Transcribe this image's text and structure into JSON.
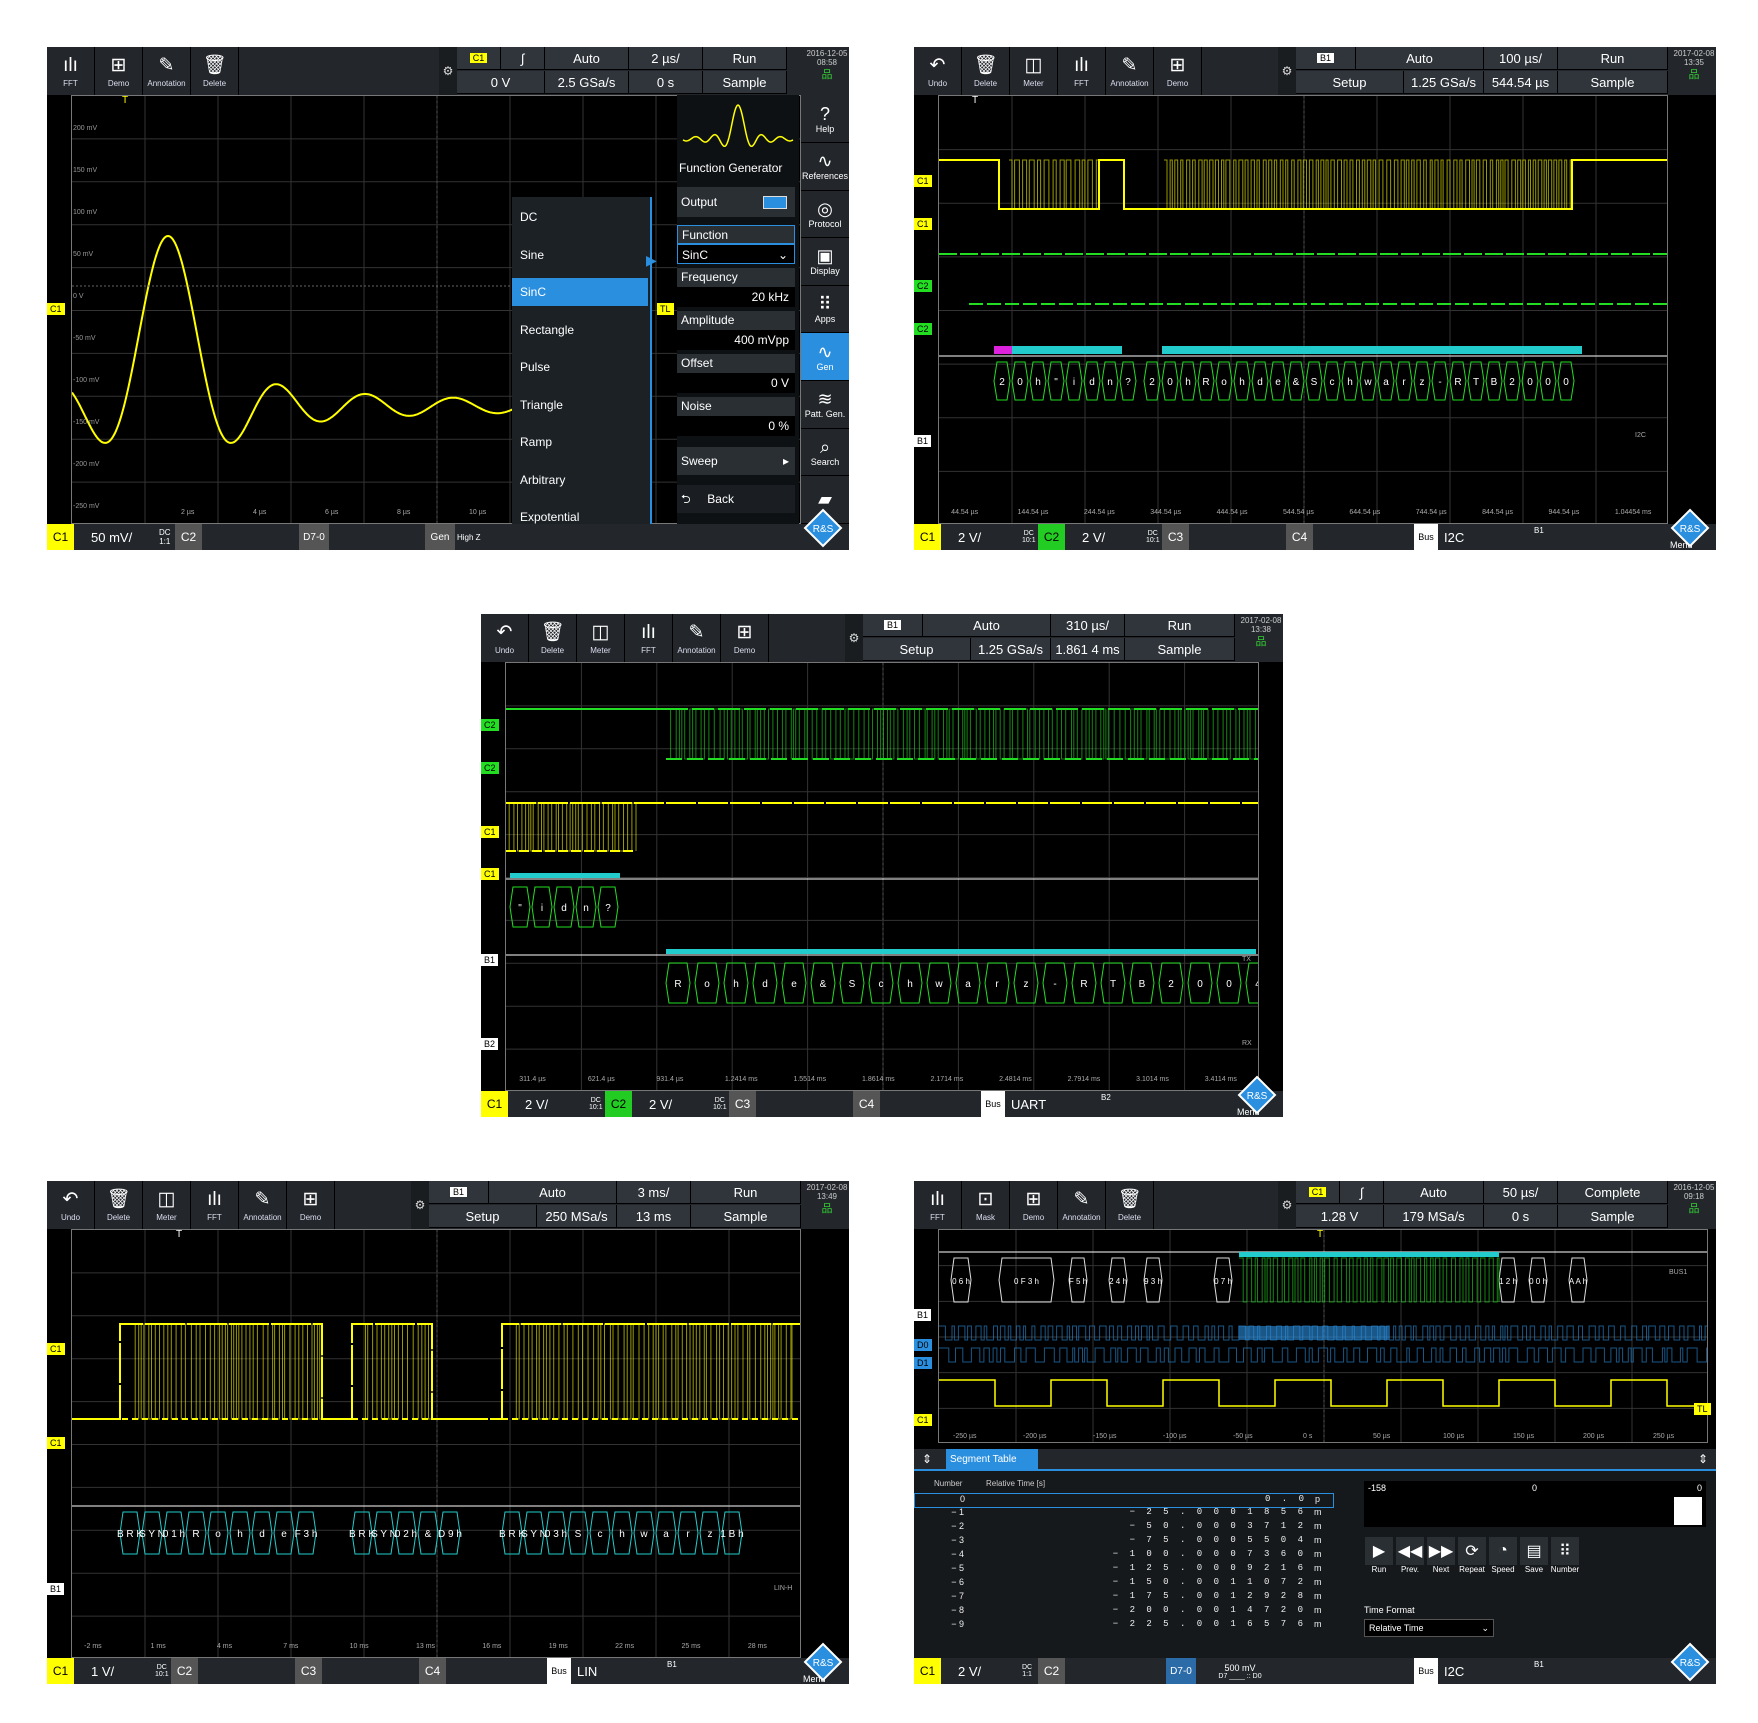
{
  "screens": [
    {
      "toolbar": [
        {
          "label": "FFT",
          "icon": "fft-icon"
        },
        {
          "label": "Demo",
          "icon": "demo-icon"
        },
        {
          "label": "Annotation",
          "icon": "pen-icon"
        },
        {
          "label": "Delete",
          "icon": "trash-icon"
        }
      ],
      "acq": {
        "ch": "C1",
        "slope": "∫",
        "mode": "Auto",
        "tb": "2 µs/",
        "run": "Run",
        "level": "0 V",
        "rate": "2.5 GSa/s",
        "pos": "0 s",
        "acqmode": "Sample"
      },
      "date": "2016-12-05",
      "time": "08:58",
      "levels": [
        "200 mV",
        "150 mV",
        "100 mV",
        "50 mV",
        "0 V",
        "-50 mV",
        "-100 mV",
        "-150 mV",
        "-200 mV",
        "-250 mV"
      ],
      "times": [
        "2 µs",
        "4 µs",
        "6 µs",
        "8 µs",
        "10 µs"
      ],
      "menu": [
        "DC",
        "Sine",
        "SinC",
        "Rectangle",
        "Pulse",
        "Triangle",
        "Ramp",
        "Arbitrary",
        "Expotential"
      ],
      "menu_selected": 2,
      "fg": {
        "title": "Function Generator",
        "output": "Output",
        "function_label": "Function",
        "function_value": "SinC",
        "frequency_label": "Frequency",
        "frequency_value": "20 kHz",
        "amplitude_label": "Amplitude",
        "amplitude_value": "400 mVpp",
        "offset_label": "Offset",
        "offset_value": "0 V",
        "noise_label": "Noise",
        "noise_value": "0 %",
        "sweep": "Sweep",
        "back": "Back"
      },
      "side": [
        {
          "label": "Help",
          "icon": "help-icon"
        },
        {
          "label": "References",
          "icon": "references-icon"
        },
        {
          "label": "Protocol",
          "icon": "protocol-icon"
        },
        {
          "label": "Display",
          "icon": "display-icon"
        },
        {
          "label": "Apps",
          "icon": "apps-icon"
        },
        {
          "label": "Gen",
          "icon": "gen-icon"
        },
        {
          "label": "Patt. Gen.",
          "icon": "pattern-icon"
        },
        {
          "label": "Search",
          "icon": "search-icon"
        },
        {
          "label": "",
          "icon": "folder-icon"
        }
      ],
      "bottom": {
        "c1": "C1",
        "c1_scale": "50 mV/",
        "c1_cpl": "DC",
        "c1_ratio": "1:1",
        "c2": "C2",
        "d70": "D7-0",
        "gen": "Gen",
        "gen_sub": "High Z"
      },
      "markers": {
        "t": "T",
        "ch": "C1",
        "tl": "TL"
      }
    },
    {
      "toolbar": [
        {
          "label": "Undo",
          "icon": "undo-icon"
        },
        {
          "label": "Delete",
          "icon": "trash-icon"
        },
        {
          "label": "Meter",
          "icon": "meter-icon"
        },
        {
          "label": "FFT",
          "icon": "fft-icon"
        },
        {
          "label": "Annotation",
          "icon": "pen-icon"
        },
        {
          "label": "Demo",
          "icon": "demo-icon"
        }
      ],
      "acq": {
        "ch": "B1",
        "mode": "Auto",
        "tb": "100 µs/",
        "run": "Run",
        "level": "Setup",
        "rate": "1.25 GSa/s",
        "pos": "544.54 µs",
        "acqmode": "Sample"
      },
      "date": "2017-02-08",
      "time": "13:35",
      "times": [
        "44.54 µs",
        "144.54 µs",
        "244.54 µs",
        "344.54 µs",
        "444.54 µs",
        "544.54 µs",
        "644.54 µs",
        "744.54 µs",
        "844.54 µs",
        "944.54 µs",
        "1.04454 ms"
      ],
      "decode1": [
        "2",
        "0",
        "h",
        "\"",
        "i",
        "d",
        "n",
        "?"
      ],
      "decode2": [
        "2",
        "0",
        "h",
        "R",
        "o",
        "h",
        "d",
        "e",
        "&",
        "S",
        "c",
        "h",
        "w",
        "a",
        "r",
        "z",
        "-",
        "R",
        "T",
        "B",
        "2",
        "0",
        "0",
        "0"
      ],
      "buslabel": "I2C",
      "chlabels": [
        "C1",
        "C1",
        "C2",
        "C2",
        "B1"
      ],
      "bottom": {
        "c1": "C1",
        "c1_scale": "2 V/",
        "c1_cpl": "DC",
        "c1_ratio": "10:1",
        "c2": "C2",
        "c2_scale": "2 V/",
        "c2_cpl": "DC",
        "c2_ratio": "10:1",
        "c3": "C3",
        "c4": "C4",
        "bus": "Bus",
        "bus_name": "I2C",
        "bus_id": "B1",
        "menu": "Menu"
      }
    },
    {
      "toolbar": [
        {
          "label": "Undo",
          "icon": "undo-icon"
        },
        {
          "label": "Delete",
          "icon": "trash-icon"
        },
        {
          "label": "Meter",
          "icon": "meter-icon"
        },
        {
          "label": "FFT",
          "icon": "fft-icon"
        },
        {
          "label": "Annotation",
          "icon": "pen-icon"
        },
        {
          "label": "Demo",
          "icon": "demo-icon"
        }
      ],
      "acq": {
        "ch": "B1",
        "mode": "Auto",
        "tb": "310 µs/",
        "run": "Run",
        "level": "Setup",
        "rate": "1.25 GSa/s",
        "pos": "1.861 4 ms",
        "acqmode": "Sample"
      },
      "date": "2017-02-08",
      "time": "13:38",
      "times": [
        "311.4 µs",
        "621.4 µs",
        "931.4 µs",
        "1.2414 ms",
        "1.5514 ms",
        "1.8614 ms",
        "2.1714 ms",
        "2.4814 ms",
        "2.7914 ms",
        "3.1014 ms",
        "3.4114 ms"
      ],
      "decode1": [
        "\"",
        "i",
        "d",
        "n",
        "?"
      ],
      "decode2": [
        "R",
        "o",
        "h",
        "d",
        "e",
        "&",
        "S",
        "c",
        "h",
        "w",
        "a",
        "r",
        "z",
        "-",
        "R",
        "T",
        "B",
        "2",
        "0",
        "0",
        "4"
      ],
      "tx": "TX",
      "rx": "RX",
      "chlabels": [
        "C2",
        "C2",
        "C1",
        "C1",
        "B1",
        "B2"
      ],
      "bottom": {
        "c1": "C1",
        "c1_scale": "2 V/",
        "c1_cpl": "DC",
        "c1_ratio": "10:1",
        "c2": "C2",
        "c2_scale": "2 V/",
        "c2_cpl": "DC",
        "c2_ratio": "10:1",
        "c3": "C3",
        "c4": "C4",
        "bus": "Bus",
        "bus_name": "UART",
        "bus_id": "B2",
        "menu": "Menu"
      }
    },
    {
      "toolbar": [
        {
          "label": "Undo",
          "icon": "undo-icon"
        },
        {
          "label": "Delete",
          "icon": "trash-icon"
        },
        {
          "label": "Meter",
          "icon": "meter-icon"
        },
        {
          "label": "FFT",
          "icon": "fft-icon"
        },
        {
          "label": "Annotation",
          "icon": "pen-icon"
        },
        {
          "label": "Demo",
          "icon": "demo-icon"
        }
      ],
      "acq": {
        "ch": "B1",
        "mode": "Auto",
        "tb": "3 ms/",
        "run": "Run",
        "level": "Setup",
        "rate": "250 MSa/s",
        "pos": "13 ms",
        "acqmode": "Sample"
      },
      "date": "2017-02-08",
      "time": "13:49",
      "times": [
        "-2 ms",
        "1 ms",
        "4 ms",
        "7 ms",
        "10 ms",
        "13 ms",
        "16 ms",
        "19 ms",
        "22 ms",
        "25 ms",
        "28 ms"
      ],
      "frames": [
        [
          "B R K",
          "S Y N",
          "0 1 h",
          "R",
          "o",
          "h",
          "d",
          "e",
          "F 3 h"
        ],
        [
          "B R K",
          "S Y N",
          "0 2 h",
          "&",
          "D 9 h"
        ],
        [
          "B R K",
          "S Y N",
          "0 3 h",
          "S",
          "c",
          "h",
          "w",
          "a",
          "r",
          "z",
          "1 B h"
        ]
      ],
      "linlabel": "LIN-H",
      "chlabels": [
        "C1",
        "C1",
        "B1"
      ],
      "bottom": {
        "c1": "C1",
        "c1_scale": "1 V/",
        "c1_cpl": "DC",
        "c1_ratio": "10:1",
        "c2": "C2",
        "c3": "C3",
        "c4": "C4",
        "bus": "Bus",
        "bus_name": "LIN",
        "bus_id": "B1",
        "menu": "Menu"
      }
    },
    {
      "toolbar": [
        {
          "label": "FFT",
          "icon": "fft-icon"
        },
        {
          "label": "Mask",
          "icon": "mask-icon"
        },
        {
          "label": "Demo",
          "icon": "demo-icon"
        },
        {
          "label": "Annotation",
          "icon": "pen-icon"
        },
        {
          "label": "Delete",
          "icon": "trash-icon"
        }
      ],
      "acq": {
        "ch": "C1",
        "slope": "∫",
        "mode": "Auto",
        "tb": "50 µs/",
        "run": "Complete",
        "level": "1.28 V",
        "rate": "179 MSa/s",
        "pos": "0 s",
        "acqmode": "Sample"
      },
      "date": "2016-12-05",
      "time": "09:18",
      "times": [
        "-250 µs",
        "-200 µs",
        "-150 µs",
        "-100 µs",
        "-50 µs",
        "0 s",
        "50 µs",
        "100 µs",
        "150 µs",
        "200 µs",
        "250 µs"
      ],
      "decode": [
        "0 6 h",
        "0 F 3 h",
        "F 5 h",
        "2 4 h",
        "9 3 h",
        "0 7 h",
        "1 2 h",
        "0 0 h",
        "A A h"
      ],
      "buslabel": "BUS1",
      "chlabels": [
        "B1",
        "D0",
        "D1",
        "C1",
        "TL"
      ],
      "segment": {
        "title": "Segment Table",
        "col1": "Number",
        "col2": "Relative Time [s]",
        "rows": [
          [
            "0",
            "0 . 0",
            "p"
          ],
          [
            "− 1",
            "− 2 5 . 0 0 0  1 8 5  6",
            "m"
          ],
          [
            "− 2",
            "− 5 0 . 0 0 0  3 7 1  2",
            "m"
          ],
          [
            "− 3",
            "− 7 5 . 0 0 0  5 5 0  4",
            "m"
          ],
          [
            "− 4",
            "− 1 0 0 . 0 0 0  7 3 6  0",
            "m"
          ],
          [
            "− 5",
            "− 1 2 5 . 0 0 0  9 2 1  6",
            "m"
          ],
          [
            "− 6",
            "− 1 5 0 . 0 0 1  1 0 7  2",
            "m"
          ],
          [
            "− 7",
            "− 1 7 5 . 0 0 1  2 9 2  8",
            "m"
          ],
          [
            "− 8",
            "− 2 0 0 . 0 0 1  4 7 2  0",
            "m"
          ],
          [
            "− 9",
            "− 2 2 5 . 0 0 1  6 5 7  6",
            "m"
          ]
        ],
        "range_min": "-158",
        "range_mid": "0",
        "range_max": "0",
        "buttons": [
          {
            "label": "Run",
            "icon": "play-icon"
          },
          {
            "label": "Prev.",
            "icon": "rewind-icon"
          },
          {
            "label": "Next",
            "icon": "forward-icon"
          },
          {
            "label": "Repeat",
            "icon": "repeat-icon"
          },
          {
            "label": "Speed",
            "icon": "speed-icon"
          },
          {
            "label": "Save",
            "icon": "save-icon"
          },
          {
            "label": "Number",
            "icon": "grid-icon"
          }
        ],
        "time_format_label": "Time Format",
        "time_format_value": "Relative Time"
      },
      "bottom": {
        "c1": "C1",
        "c1_scale": "2 V/",
        "c1_cpl": "DC",
        "c1_ratio": "1:1",
        "c2": "C2",
        "d70": "D7-0",
        "d_scale": "500 mV",
        "d_sub": "D7 ____ :: D0",
        "bus": "Bus",
        "bus_name": "I2C",
        "bus_id": "B1"
      }
    }
  ],
  "colors": {
    "yellow": "#ffff00",
    "green": "#22dd22",
    "cyan": "#22cccc",
    "blue": "#2b8fe0",
    "red": "#dd2222",
    "magenta": "#dd22dd"
  }
}
